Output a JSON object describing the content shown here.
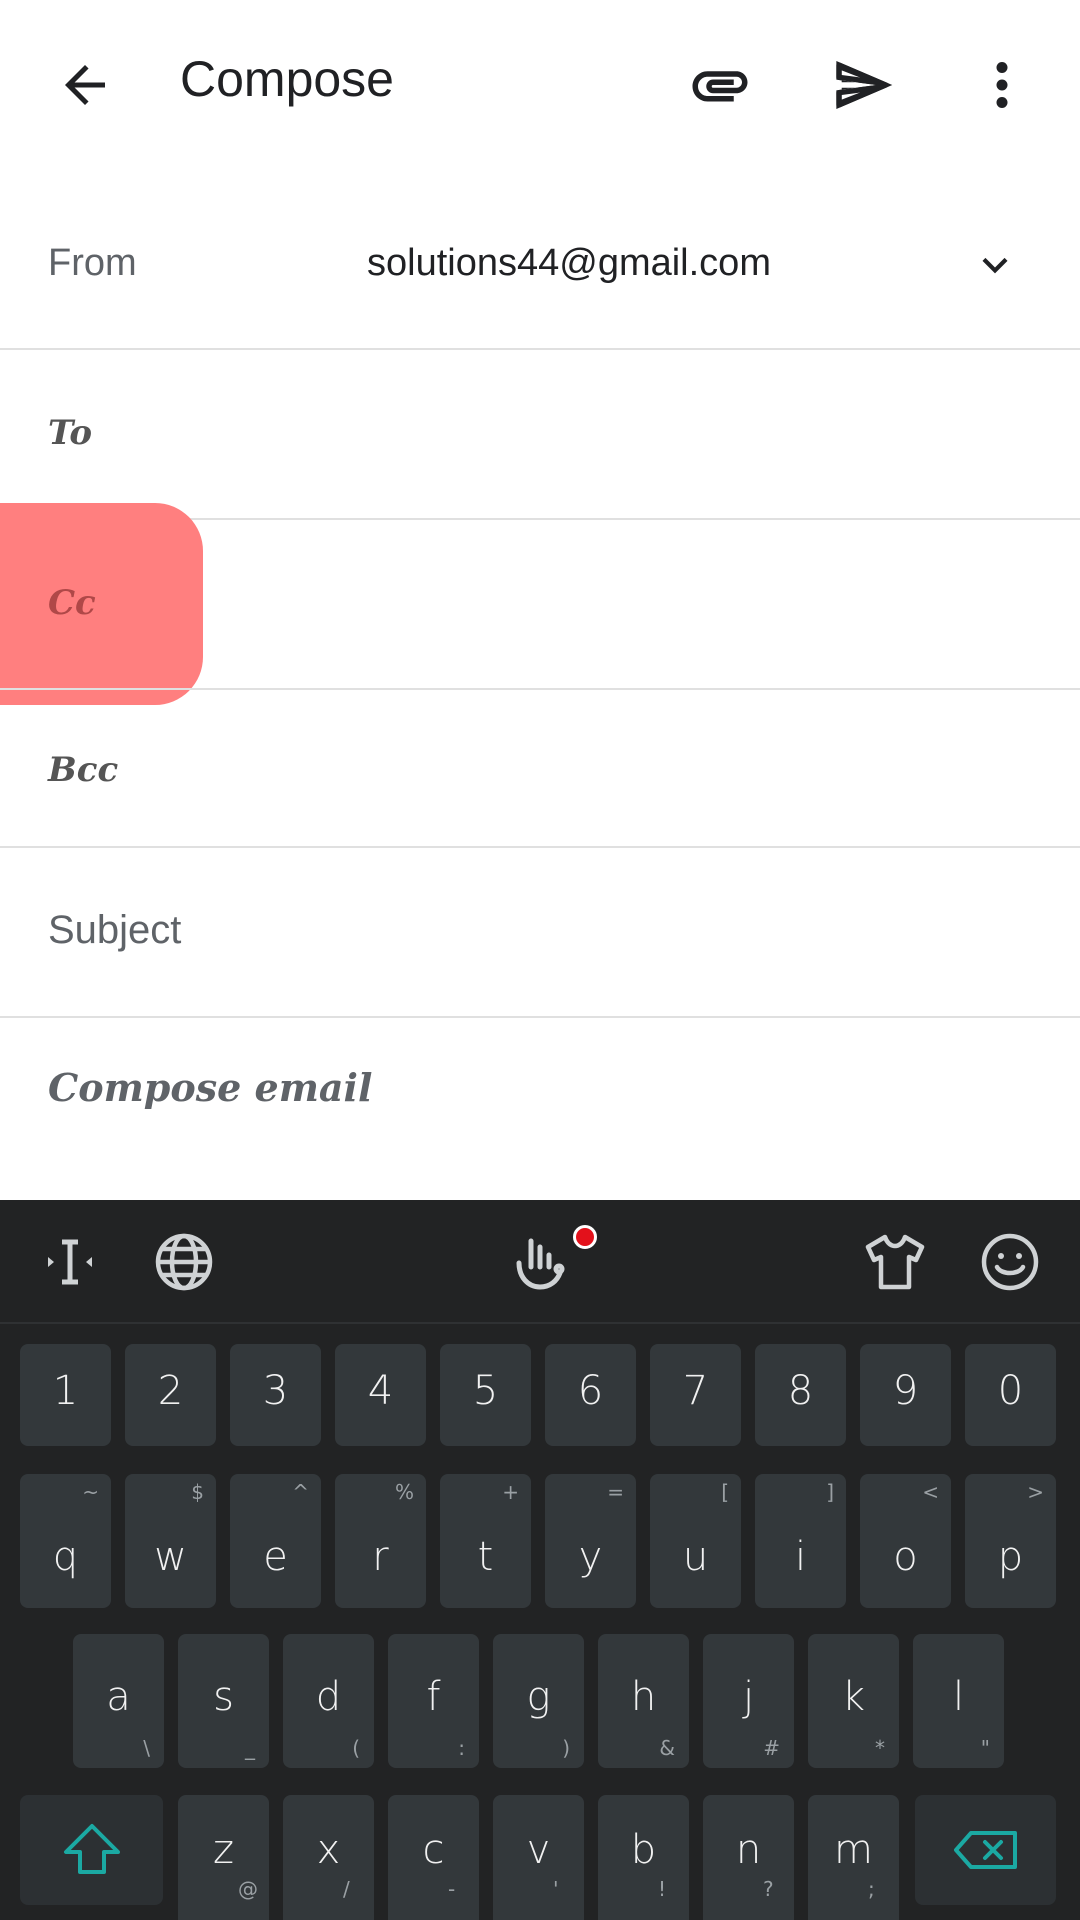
{
  "appbar": {
    "title": "Compose",
    "icons": {
      "back": "arrow-back-icon",
      "attach": "paperclip-icon",
      "send": "send-icon",
      "more": "more-vert-icon"
    }
  },
  "from": {
    "label": "From",
    "value": "solutions44@gmail.com",
    "dropdown_icon": "chevron-down-icon"
  },
  "to": {
    "label": "To"
  },
  "cc": {
    "label": "Cc"
  },
  "bcc": {
    "label": "Bcc"
  },
  "subject": {
    "placeholder": "Subject"
  },
  "body": {
    "placeholder": "Compose email"
  },
  "colors": {
    "touch_highlight": "#ff7f7f",
    "keyboard_bg": "#222324",
    "key_bg": "#33383b",
    "accent": "#1ba9a3",
    "notification_dot": "#e3111b"
  },
  "keyboard": {
    "toolbar_icons": [
      "text-cursor-icon",
      "globe-icon",
      "gesture-hand-icon",
      "shirt-theme-icon",
      "emoji-icon"
    ],
    "numbers": [
      "1",
      "2",
      "3",
      "4",
      "5",
      "6",
      "7",
      "8",
      "9",
      "0"
    ],
    "row1": [
      {
        "key": "q",
        "hint": "~"
      },
      {
        "key": "w",
        "hint": "$"
      },
      {
        "key": "e",
        "hint": "^"
      },
      {
        "key": "r",
        "hint": "%"
      },
      {
        "key": "t",
        "hint": "+"
      },
      {
        "key": "y",
        "hint": "="
      },
      {
        "key": "u",
        "hint": "["
      },
      {
        "key": "i",
        "hint": "]"
      },
      {
        "key": "o",
        "hint": "<"
      },
      {
        "key": "p",
        "hint": ">"
      }
    ],
    "row2": [
      {
        "key": "a",
        "hint": "\\"
      },
      {
        "key": "s",
        "hint": "_"
      },
      {
        "key": "d",
        "hint": "("
      },
      {
        "key": "f",
        "hint": ":"
      },
      {
        "key": "g",
        "hint": ")"
      },
      {
        "key": "h",
        "hint": "&"
      },
      {
        "key": "j",
        "hint": "#"
      },
      {
        "key": "k",
        "hint": "*"
      },
      {
        "key": "l",
        "hint": "\""
      }
    ],
    "row3": [
      {
        "key": "z",
        "hint": "@"
      },
      {
        "key": "x",
        "hint": "/"
      },
      {
        "key": "c",
        "hint": "-"
      },
      {
        "key": "v",
        "hint": "'"
      },
      {
        "key": "b",
        "hint": "!"
      },
      {
        "key": "n",
        "hint": "?"
      },
      {
        "key": "m",
        "hint": ";"
      }
    ],
    "shift_icon": "shift-arrow-icon",
    "backspace_icon": "backspace-icon"
  }
}
